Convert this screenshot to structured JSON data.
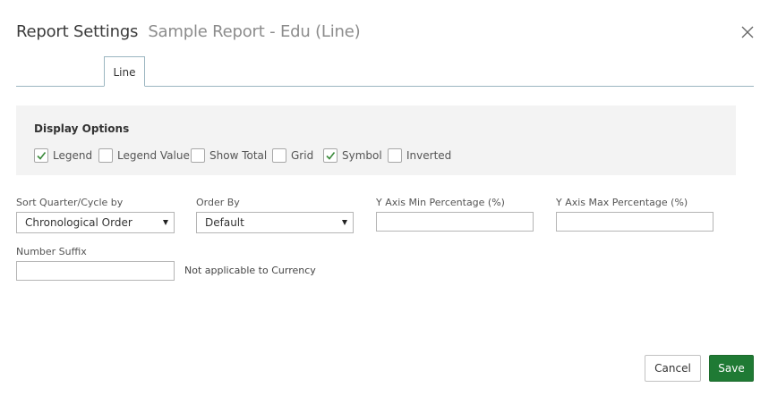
{
  "header": {
    "title": "Report Settings",
    "subtitle": "Sample Report - Edu (Line)",
    "close_icon": "close-icon"
  },
  "tabs": [
    {
      "label": "Line",
      "active": true
    }
  ],
  "display_options": {
    "title": "Display Options",
    "options": [
      {
        "label": "Legend",
        "checked": true
      },
      {
        "label": "Legend Value",
        "checked": false
      },
      {
        "label": "Show Total",
        "checked": false
      },
      {
        "label": "Grid",
        "checked": false
      },
      {
        "label": "Symbol",
        "checked": true
      },
      {
        "label": "Inverted",
        "checked": false
      }
    ]
  },
  "fields": {
    "sort": {
      "label": "Sort Quarter/Cycle by",
      "value": "Chronological Order"
    },
    "order_by": {
      "label": "Order By",
      "value": "Default"
    },
    "y_min": {
      "label": "Y Axis Min Percentage (%)",
      "value": ""
    },
    "y_max": {
      "label": "Y Axis Max Percentage (%)",
      "value": ""
    },
    "number_suffix": {
      "label": "Number Suffix",
      "value": "",
      "note": "Not applicable to Currency"
    }
  },
  "footer": {
    "cancel_label": "Cancel",
    "save_label": "Save"
  },
  "colors": {
    "accent": "#1f7a34",
    "check": "#3a8a3a",
    "tab_border": "#9bb6c0",
    "panel_bg": "#f3f3f3"
  }
}
